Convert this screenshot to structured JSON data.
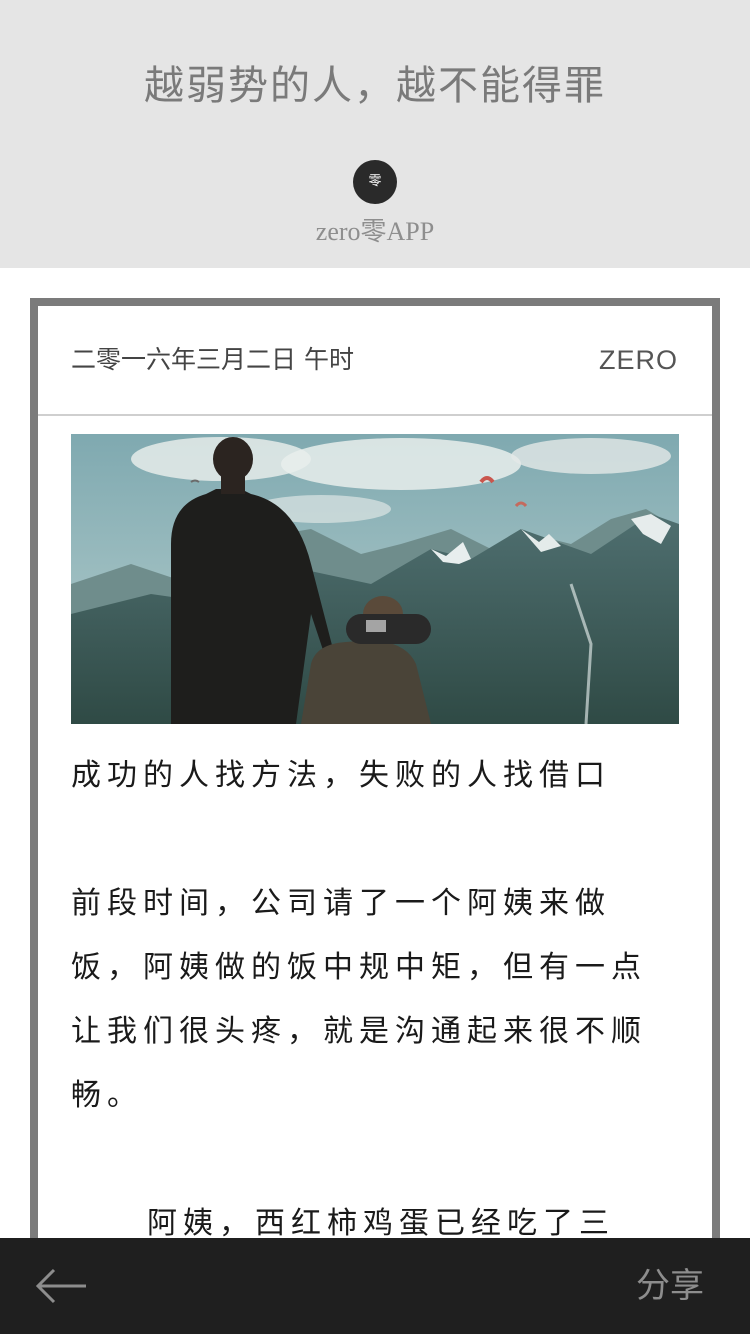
{
  "header": {
    "title": "越弱势的人，越不能得罪",
    "avatar_glyph": "零",
    "author": "zero零APP",
    "background": "#e5e5e5"
  },
  "card": {
    "date": "二零一六年三月二日 午时",
    "brand": "ZERO",
    "border_color": "#7b7b7b"
  },
  "image": {
    "icon": "mountain-photo"
  },
  "article": {
    "subtitle": "成功的人找方法，失败的人找借口",
    "paragraph_1": "前段时间，公司请了一个阿姨来做饭，阿姨做的饭中规中矩，但有一点让我们很头疼，就是沟通起来很不顺畅。",
    "paragraph_2": "阿姨，西红柿鸡蛋已经吃了三"
  },
  "bottom_bar": {
    "back_icon": "arrow-left-icon",
    "share_label": "分享",
    "background": "#1f1f1f"
  }
}
